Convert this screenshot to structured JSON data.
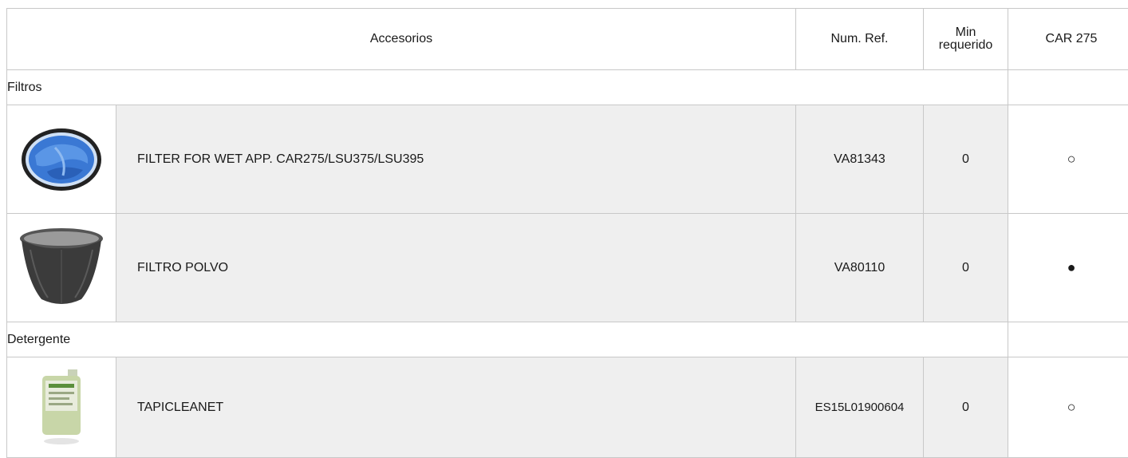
{
  "header": {
    "accessories": "Accesorios",
    "ref": "Num. Ref.",
    "min_line1": "Min",
    "min_line2": "requerido",
    "model": "CAR 275"
  },
  "sections": [
    {
      "category": "Filtros",
      "items": [
        {
          "description": "FILTER FOR WET APP. CAR275/LSU375/LSU395",
          "ref": "VA81343",
          "min": "0",
          "availability": "○",
          "image": "wet-filter-icon"
        },
        {
          "description": "FILTRO POLVO",
          "ref": "VA80110",
          "min": "0",
          "availability": "●",
          "image": "dust-filter-icon"
        }
      ]
    },
    {
      "category": "Detergente",
      "items": [
        {
          "description": "TAPICLEANET",
          "ref": "ES15L01900604",
          "min": "0",
          "availability": "○",
          "image": "detergent-bottle-icon"
        }
      ]
    }
  ]
}
